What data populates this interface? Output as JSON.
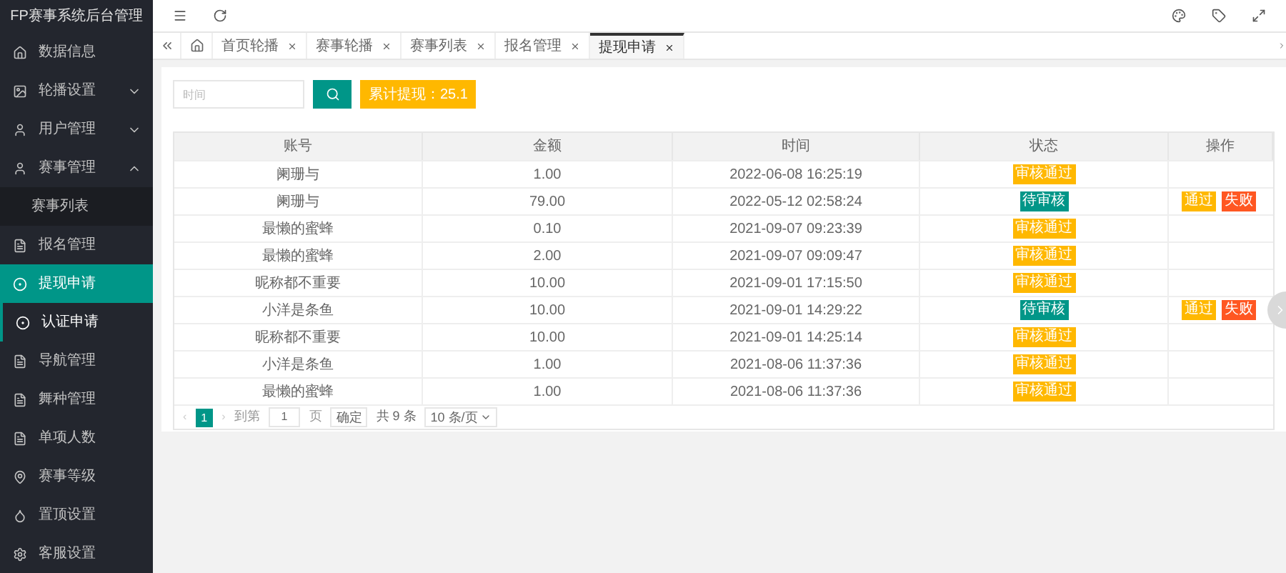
{
  "app_title": "FP赛事系统后台管理",
  "sidebar": {
    "items": [
      {
        "label": "数据信息",
        "selected": false,
        "focused": false
      },
      {
        "label": "轮播设置",
        "selected": false,
        "focused": false,
        "expanded": false
      },
      {
        "label": "用户管理",
        "selected": false,
        "focused": false,
        "expanded": false
      },
      {
        "label": "赛事管理",
        "selected": false,
        "focused": false,
        "expanded": true,
        "children": [
          {
            "label": "赛事列表",
            "selected": false
          }
        ]
      },
      {
        "label": "报名管理",
        "selected": false,
        "focused": false
      },
      {
        "label": "提现申请",
        "selected": true,
        "focused": false
      },
      {
        "label": "认证申请",
        "selected": false,
        "focused": true
      },
      {
        "label": "导航管理",
        "selected": false,
        "focused": false
      },
      {
        "label": "舞种管理",
        "selected": false,
        "focused": false
      },
      {
        "label": "单项人数",
        "selected": false,
        "focused": false
      },
      {
        "label": "赛事等级",
        "selected": false,
        "focused": false
      },
      {
        "label": "置顶设置",
        "selected": false,
        "focused": false
      },
      {
        "label": "客服设置",
        "selected": false,
        "focused": false
      }
    ]
  },
  "tabs": [
    {
      "label": "首页轮播",
      "selected": false
    },
    {
      "label": "赛事轮播",
      "selected": false
    },
    {
      "label": "赛事列表",
      "selected": false
    },
    {
      "label": "报名管理",
      "selected": false
    },
    {
      "label": "提现申请",
      "selected": true
    }
  ],
  "filter": {
    "placeholder": "时间",
    "total_button": "累计提现：25.1"
  },
  "table": {
    "columns": [
      "账号",
      "金额",
      "时间",
      "状态",
      "操作"
    ],
    "rows": [
      {
        "account": "阑珊与",
        "amount": "1.00",
        "time": "2022-06-08 16:25:19",
        "status": {
          "kind": "approved",
          "label": "审核通过"
        }
      },
      {
        "account": "阑珊与",
        "amount": "79.00",
        "time": "2022-05-12 02:58:24",
        "status": {
          "kind": "pending",
          "label": "待审核"
        },
        "actions": [
          "通过",
          "失败"
        ]
      },
      {
        "account": "最懒的蜜蜂",
        "amount": "0.10",
        "time": "2021-09-07 09:23:39",
        "status": {
          "kind": "approved",
          "label": "审核通过"
        }
      },
      {
        "account": "最懒的蜜蜂",
        "amount": "2.00",
        "time": "2021-09-07 09:09:47",
        "status": {
          "kind": "approved",
          "label": "审核通过"
        }
      },
      {
        "account": "昵称都不重要",
        "amount": "10.00",
        "time": "2021-09-01 17:15:50",
        "status": {
          "kind": "approved",
          "label": "审核通过"
        }
      },
      {
        "account": "小洋是条鱼",
        "amount": "10.00",
        "time": "2021-09-01 14:29:22",
        "status": {
          "kind": "pending",
          "label": "待审核"
        },
        "actions": [
          "通过",
          "失败"
        ]
      },
      {
        "account": "昵称都不重要",
        "amount": "10.00",
        "time": "2021-09-01 14:25:14",
        "status": {
          "kind": "approved",
          "label": "审核通过"
        }
      },
      {
        "account": "小洋是条鱼",
        "amount": "1.00",
        "time": "2021-08-06 11:37:36",
        "status": {
          "kind": "approved",
          "label": "审核通过"
        }
      },
      {
        "account": "最懒的蜜蜂",
        "amount": "1.00",
        "time": "2021-08-06 11:37:36",
        "status": {
          "kind": "approved",
          "label": "审核通过"
        }
      }
    ]
  },
  "pagination": {
    "prev": "‹",
    "pages": [
      {
        "label": "1",
        "selected": true
      }
    ],
    "next": "›",
    "goto_label": "到第",
    "goto_value": "1",
    "page_unit": "页",
    "confirm": "确定",
    "total": "共 9 条",
    "page_size": "10 条/页"
  }
}
